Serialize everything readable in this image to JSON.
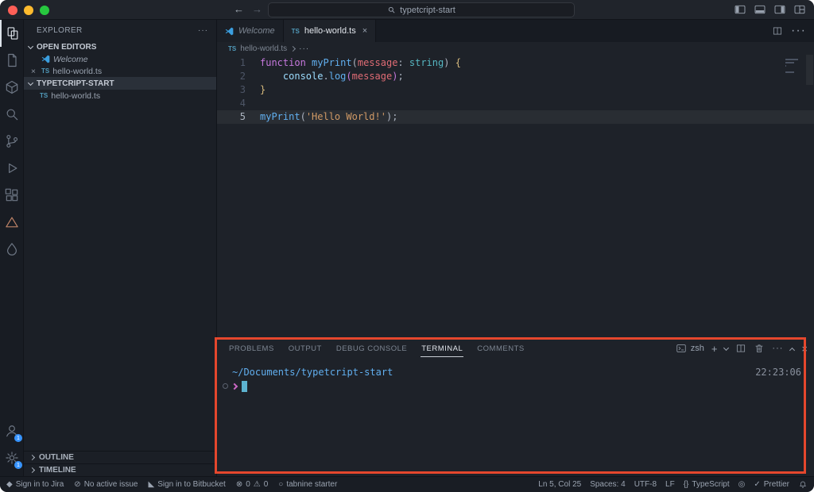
{
  "colors": {
    "annotation": "#e5472d",
    "accent_blue": "#61afef",
    "keyword_purple": "#c678dd",
    "string_orange": "#d19a66",
    "param_red": "#e06c75",
    "type_cyan": "#56b6c2",
    "badge_blue": "#3794ff"
  },
  "titlebar": {
    "search_value": "typetcript-start"
  },
  "activity_bar": {
    "badges": {
      "accounts": "1",
      "settings": "1"
    }
  },
  "sidebar": {
    "title": "EXPLORER",
    "header_more": "···",
    "open_editors": {
      "label": "OPEN EDITORS",
      "items": [
        {
          "label": "Welcome",
          "icon": "vscode",
          "preview": true
        },
        {
          "label": "hello-world.ts",
          "icon": "ts",
          "closable": true
        }
      ]
    },
    "workspace": {
      "label": "TYPETCRIPT-START",
      "items": [
        {
          "label": "hello-world.ts",
          "icon": "ts"
        }
      ]
    },
    "outline_label": "OUTLINE",
    "timeline_label": "TIMELINE"
  },
  "editor_tabs": [
    {
      "label": "Welcome",
      "icon": "vscode",
      "preview": true,
      "active": false
    },
    {
      "label": "hello-world.ts",
      "icon": "ts",
      "active": true,
      "closable": true
    }
  ],
  "tab_actions_more": "···",
  "breadcrumb": {
    "file": "hello-world.ts",
    "more": "···"
  },
  "editor": {
    "lines": [
      {
        "num": 1,
        "tokens": [
          {
            "s": "keyword",
            "t": "function "
          },
          {
            "s": "func",
            "t": "myPrint"
          },
          {
            "s": "punct",
            "t": "("
          },
          {
            "s": "param",
            "t": "message"
          },
          {
            "s": "punct",
            "t": ": "
          },
          {
            "s": "type",
            "t": "string"
          },
          {
            "s": "punct",
            "t": ") "
          },
          {
            "s": "brace",
            "t": "{"
          }
        ]
      },
      {
        "num": 2,
        "tokens": [
          {
            "s": "plain",
            "t": "    "
          },
          {
            "s": "object",
            "t": "console"
          },
          {
            "s": "punct",
            "t": "."
          },
          {
            "s": "func",
            "t": "log"
          },
          {
            "s": "paren2",
            "t": "("
          },
          {
            "s": "param",
            "t": "message"
          },
          {
            "s": "paren2",
            "t": ")"
          },
          {
            "s": "punct",
            "t": ";"
          }
        ]
      },
      {
        "num": 3,
        "tokens": [
          {
            "s": "brace",
            "t": "}"
          }
        ]
      },
      {
        "num": 4,
        "tokens": []
      },
      {
        "num": 5,
        "current": true,
        "tokens": [
          {
            "s": "func",
            "t": "myPrint"
          },
          {
            "s": "punct",
            "t": "("
          },
          {
            "s": "string",
            "t": "'Hello World!'"
          },
          {
            "s": "punct",
            "t": ")"
          },
          {
            "s": "punct",
            "t": ";"
          }
        ]
      }
    ]
  },
  "panel": {
    "tabs": [
      {
        "label": "PROBLEMS"
      },
      {
        "label": "OUTPUT"
      },
      {
        "label": "DEBUG CONSOLE"
      },
      {
        "label": "TERMINAL",
        "active": true
      },
      {
        "label": "COMMENTS"
      }
    ],
    "shell": "zsh",
    "actions_more": "···",
    "terminal": {
      "cwd": "~/Documents/typetcript-start",
      "timestamp": "22:23:06"
    }
  },
  "statusbar": {
    "left": [
      {
        "name": "jira-signin",
        "glyph": "◆",
        "label": "Sign in to Jira"
      },
      {
        "name": "active-issue",
        "glyph": "⊘",
        "label": "No active issue"
      },
      {
        "name": "bitbucket-signin",
        "glyph": "◣",
        "label": "Sign in to Bitbucket"
      },
      {
        "name": "problems",
        "glyph": "⊗",
        "label": "0",
        "glyph2": "⚠",
        "label2": "0"
      },
      {
        "name": "tabnine",
        "glyph": "○",
        "label": "tabnine starter"
      }
    ],
    "right": [
      {
        "name": "cursor-position",
        "label": "Ln 5, Col 25"
      },
      {
        "name": "indentation",
        "label": "Spaces: 4"
      },
      {
        "name": "encoding",
        "label": "UTF-8"
      },
      {
        "name": "eol",
        "label": "LF"
      },
      {
        "name": "language-mode",
        "glyph": "{}",
        "label": "TypeScript"
      },
      {
        "name": "status-extension",
        "glyph": "◎",
        "label": ""
      },
      {
        "name": "prettier",
        "glyph": "✓",
        "label": "Prettier"
      },
      {
        "name": "notifications",
        "icon": "bell",
        "label": ""
      }
    ]
  }
}
